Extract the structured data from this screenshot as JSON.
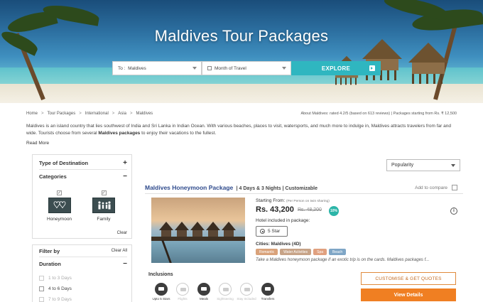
{
  "hero": {
    "title": "Maldives Tour Packages",
    "to_label": "To :",
    "to_value": "Maldives",
    "month_label": "Month of Travel",
    "explore_label": "EXPLORE"
  },
  "breadcrumb": [
    "Home",
    "Tour Packages",
    "International",
    "Asia",
    "Maldives"
  ],
  "about": "About Maldives: rated 4.2/5 (based on 613 reviews) | Packages starting from Rs. ₹ 12,500",
  "intro": {
    "text1": "Maldives is an island country that lies southwest of India and Sri Lanka in Indian Ocean. With various beaches, places to visit, watersports, and much more to indulge in, Maldives attracts travelers from far and wide. Tourists choose from several ",
    "bold": "Maldives packages",
    "text2": " to enjoy their vacations to the fullest.",
    "read_more": "Read More"
  },
  "sidebar": {
    "type_of_destination": "Type of Destination",
    "categories": "Categories",
    "cat_honeymoon": "Honeymoon",
    "cat_family": "Family",
    "clear": "Clear",
    "filter_by": "Filter by",
    "clear_all": "Clear All",
    "duration": "Duration",
    "durations": [
      "1 to 3 Days",
      "4 to 6 Days",
      "7 to 9 Days"
    ]
  },
  "sort": {
    "selected": "Popularity"
  },
  "package": {
    "title": "Maldives Honeymoon Package",
    "meta": "| 4 Days & 3 Nights | Customizable",
    "add_compare": "Add to compare",
    "starting_from": "Starting From:",
    "per_person": "(Per Person on twin sharing)",
    "price": "Rs. 43,200",
    "old_price": "Rs. 48,200",
    "discount": "10%",
    "hotel_label": "Hotel included in package:",
    "star": "5 Star",
    "cities": "Cities: Maldives (4D)",
    "tags": [
      "Romantic",
      "Water Activities",
      "Spa",
      "Beach"
    ],
    "description": "Take a Maldives honeymoon package if an exotic trip is on the cards. Maldives packages f...",
    "inclusions_title": "Inclusions",
    "inclusions": [
      "Upto 5 Stars",
      "Flights",
      "Meals",
      "Sightseeing",
      "Stay Included",
      "Transfers"
    ],
    "customise_label": "CUSTOMISE & GET QUOTES",
    "view_label": "View Details"
  },
  "colors": {
    "accent": "#f07f22",
    "teal": "#2fb6c0",
    "title_blue": "#2e4a8c",
    "tag_colors": [
      "#d9a27a",
      "#c7a387",
      "#e0a07f",
      "#7fa6c6"
    ]
  }
}
